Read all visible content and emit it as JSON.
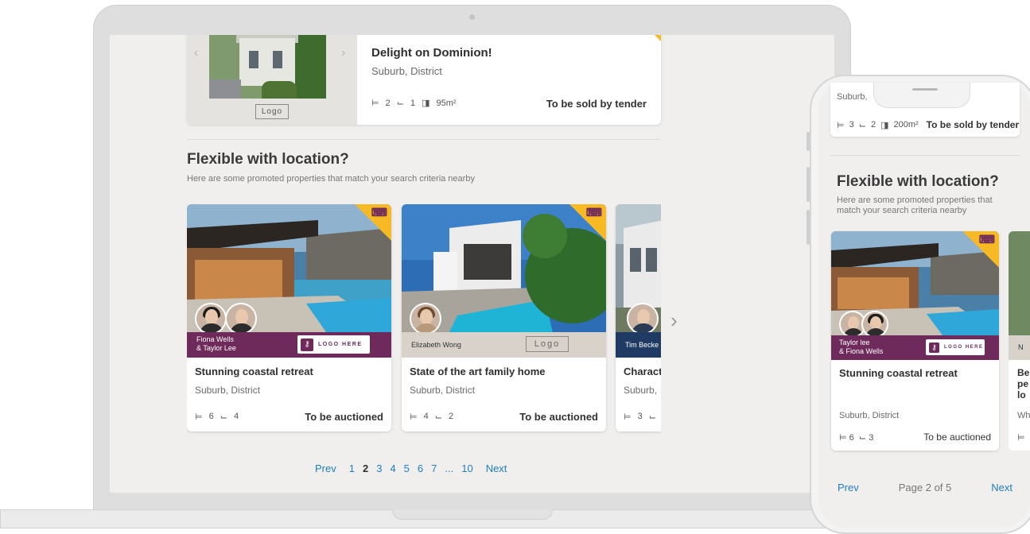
{
  "laptop": {
    "listing": {
      "title": "Delight on Dominion!",
      "suburb": "Suburb, District",
      "beds": "2",
      "baths": "1",
      "area": "95m²",
      "sale_method": "To be sold by tender",
      "logo": "Logo"
    },
    "section": {
      "heading": "Flexible with location?",
      "subheading": "Here are some promoted properties that match your search criteria nearby"
    },
    "cards": [
      {
        "title": "Stunning coastal retreat",
        "suburb": "Suburb, District",
        "beds": "6",
        "baths": "4",
        "sale_method": "To be auctioned",
        "agents_line1": "Fiona Wells",
        "agents_line2": "& Taylor Lee",
        "logo_text": "LOGO HERE"
      },
      {
        "title": "State of the art family home",
        "suburb": "Suburb, District",
        "beds": "4",
        "baths": "2",
        "sale_method": "To be auctioned",
        "agent": "Elizabeth Wong",
        "logo_text": "Logo"
      },
      {
        "title": "Charact",
        "suburb": "Suburb,",
        "beds": "3",
        "baths": "",
        "agent": "Tim Becke"
      }
    ],
    "pagination": {
      "prev": "Prev",
      "pages": [
        "1",
        "2",
        "3",
        "4",
        "5",
        "6",
        "7"
      ],
      "current": "2",
      "ellipsis": "...",
      "last": "10",
      "next": "Next"
    }
  },
  "phone": {
    "top_card": {
      "suburb": "Suburb,",
      "beds": "3",
      "baths": "2",
      "area": "200m²",
      "sale_method": "To be sold by tender"
    },
    "section": {
      "heading": "Flexible with location?",
      "subheading": "Here are some promoted properties that match your search criteria nearby"
    },
    "card": {
      "title": "Stunning coastal retreat",
      "suburb": "Suburb, District",
      "beds": "6",
      "baths": "3",
      "sale_method": "To be auctioned",
      "agents_line1": "Taylor lee",
      "agents_line2": "& Fiona Wells",
      "logo_text": "LOGO HERE"
    },
    "card2_peek": {
      "title_l1": "Be",
      "title_l2": "pe",
      "title_l3": "lo",
      "suburb": "Wh",
      "banner": "N"
    },
    "pagination": {
      "prev": "Prev",
      "info": "Page 2 of 5",
      "next": "Next"
    }
  },
  "colors": {
    "brand_purple": "#6e2a5a",
    "promo_yellow": "#f7b924",
    "link_blue": "#1e7fc2",
    "page_bg": "#f0efed"
  },
  "icons": [
    "bed-icon",
    "bath-icon",
    "area-icon",
    "promoted-icon",
    "key-icon",
    "chevron-left-icon",
    "chevron-right-icon"
  ]
}
